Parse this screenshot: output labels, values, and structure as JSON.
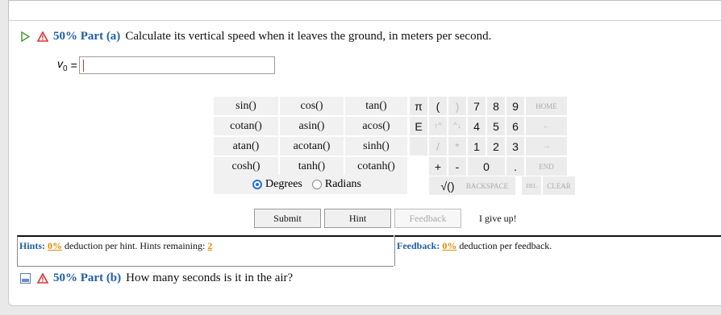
{
  "part_a": {
    "label": "50% Part (a)",
    "question": "Calculate its vertical speed when it leaves the ground, in meters per second."
  },
  "answer_field": {
    "variable": "v",
    "subscript": "0",
    "equals": "=",
    "value": ""
  },
  "functions": {
    "row1": [
      "sin()",
      "cos()",
      "tan()"
    ],
    "row2": [
      "cotan()",
      "asin()",
      "acos()"
    ],
    "row3": [
      "atan()",
      "acotan()",
      "sinh()"
    ],
    "row4": [
      "cosh()",
      "tanh()",
      "cotanh()"
    ],
    "degrees": "Degrees",
    "radians": "Radians"
  },
  "keys": {
    "row1": [
      "π",
      "(",
      ")",
      "7",
      "8",
      "9",
      "HOME"
    ],
    "row2": [
      "E",
      "↑^",
      "^↓",
      "4",
      "5",
      "6",
      "←"
    ],
    "row3": [
      "",
      "/",
      "*",
      "1",
      "2",
      "3",
      "→"
    ],
    "row4": [
      "+",
      "-",
      "0",
      ".",
      "END"
    ],
    "row5": [
      "√()",
      "BACKSPACE",
      "DEL",
      "CLEAR"
    ]
  },
  "buttons": {
    "submit": "Submit",
    "hint": "Hint",
    "feedback": "Feedback",
    "give_up": "I give up!"
  },
  "hints": {
    "prefix": "Hints:",
    "pct": "0%",
    "text": "deduction per hint. Hints remaining:",
    "remaining": "2"
  },
  "feedback": {
    "prefix": "Feedback:",
    "pct": "0%",
    "text": "deduction per feedback."
  },
  "part_b": {
    "label": "50% Part (b)",
    "question": "How many seconds is it in the air?"
  },
  "colors": {
    "accent": "#1f5fa8",
    "warning": "#d33",
    "percent": "#e08a00"
  }
}
